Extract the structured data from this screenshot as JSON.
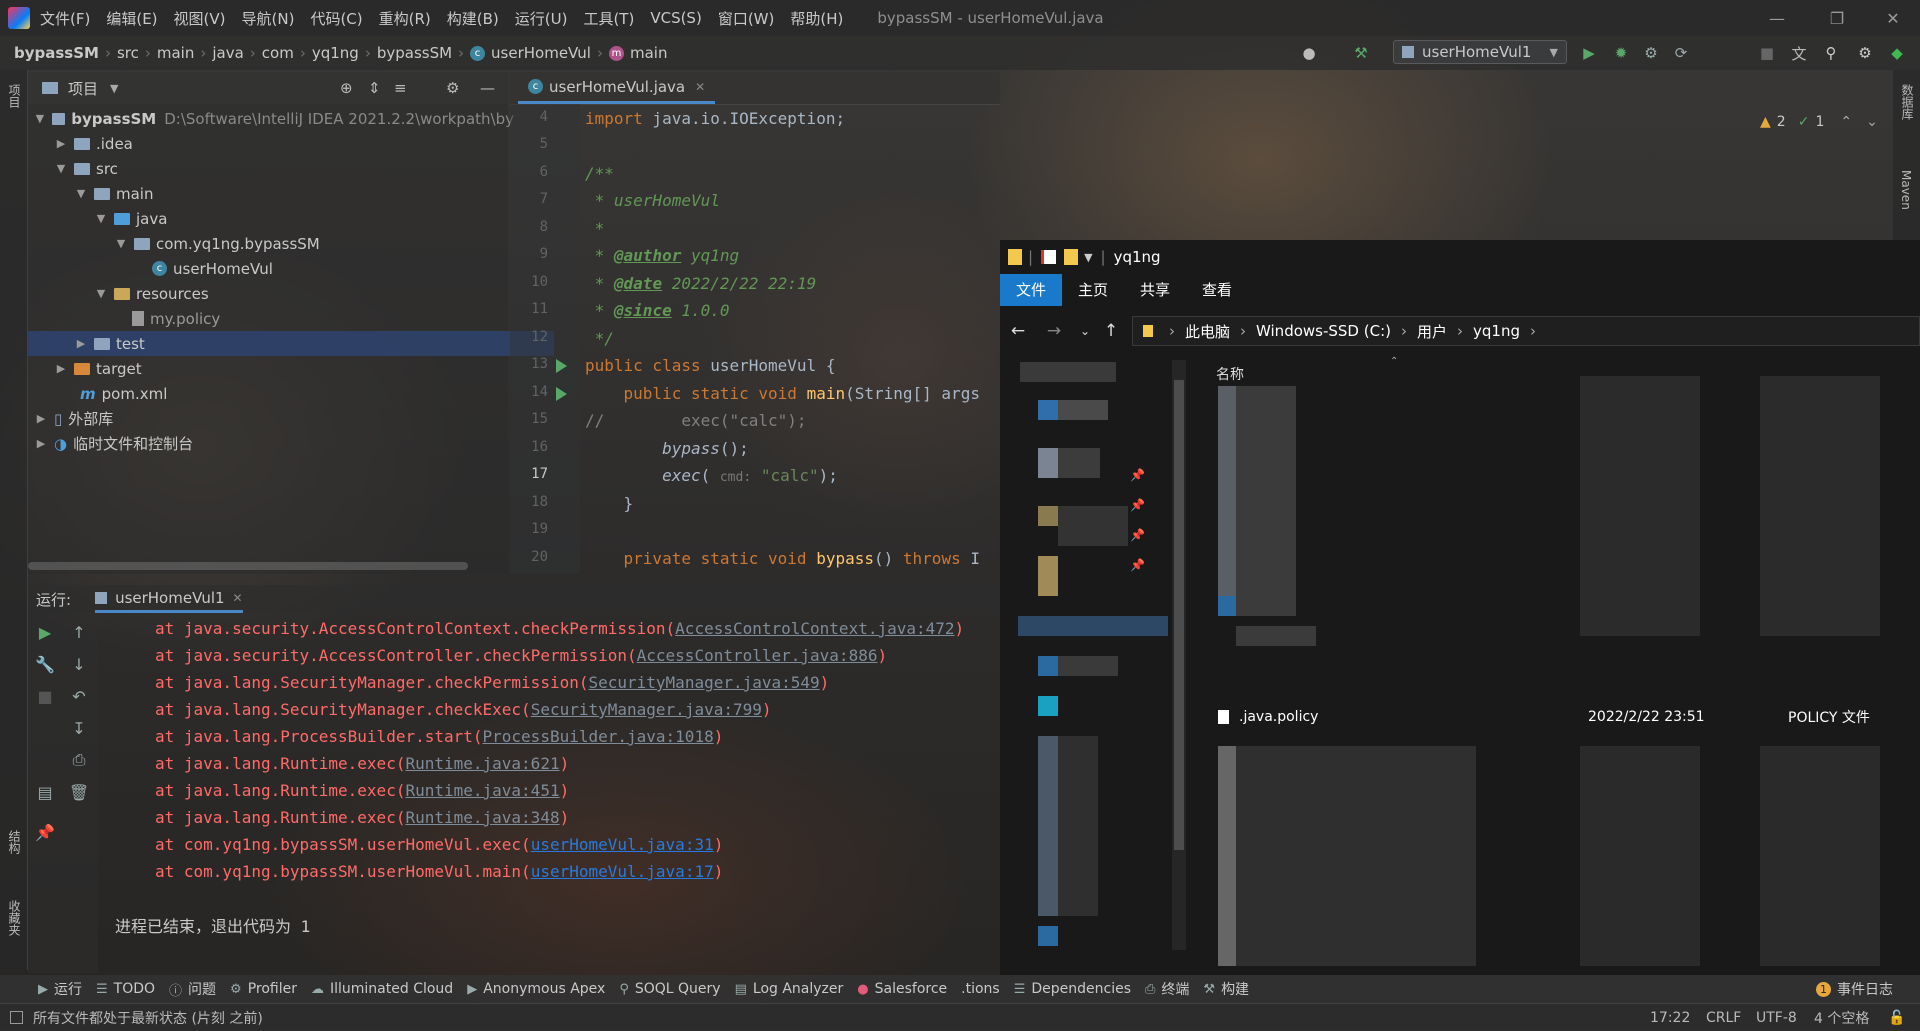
{
  "window": {
    "title": "bypassSM - userHomeVul.java",
    "menu": [
      "文件(F)",
      "编辑(E)",
      "视图(V)",
      "导航(N)",
      "代码(C)",
      "重构(R)",
      "构建(B)",
      "运行(U)",
      "工具(T)",
      "VCS(S)",
      "窗口(W)",
      "帮助(H)"
    ]
  },
  "breadcrumb": [
    "bypassSM",
    "src",
    "main",
    "java",
    "com",
    "yq1ng",
    "bypassSM",
    "userHomeVul",
    "main"
  ],
  "run_config": "userHomeVul1",
  "left_strip": {
    "project_label": "项目",
    "structure_label": "结构",
    "favorites_label": "收藏夹"
  },
  "right_strip": {
    "database_label": "数据库",
    "maven_label": "Maven"
  },
  "project": {
    "header": "项目",
    "tree": [
      {
        "label": "bypassSM",
        "extra": "D:\\Software\\IntelliJ IDEA 2021.2.2\\workpath\\by"
      },
      {
        "label": ".idea"
      },
      {
        "label": "src"
      },
      {
        "label": "main"
      },
      {
        "label": "java"
      },
      {
        "label": "com.yq1ng.bypassSM"
      },
      {
        "label": "userHomeVul"
      },
      {
        "label": "resources"
      },
      {
        "label": "my.policy"
      },
      {
        "label": "test"
      },
      {
        "label": "target"
      },
      {
        "label": "pom.xml"
      },
      {
        "label": "外部库"
      },
      {
        "label": "临时文件和控制台"
      }
    ]
  },
  "editor": {
    "tab": "userHomeVul.java",
    "inspections": {
      "warnings": "2",
      "ok": "1"
    },
    "line_numbers": [
      "4",
      "5",
      "6",
      "7",
      "8",
      "9",
      "10",
      "11",
      "12",
      "13",
      "14",
      "15",
      "16",
      "17",
      "18",
      "19",
      "20"
    ]
  },
  "run_panel": {
    "label": "运行:",
    "tab": "userHomeVul1",
    "stack": [
      {
        "text": "at java.security.AccessControlContext.checkPermission(",
        "link": "AccessControlContext.java:472",
        "end": ")"
      },
      {
        "text": "at java.security.AccessController.checkPermission(",
        "link": "AccessController.java:886",
        "end": ")"
      },
      {
        "text": "at java.lang.SecurityManager.checkPermission(",
        "link": "SecurityManager.java:549",
        "end": ")"
      },
      {
        "text": "at java.lang.SecurityManager.checkExec(",
        "link": "SecurityManager.java:799",
        "end": ")"
      },
      {
        "text": "at java.lang.ProcessBuilder.start(",
        "link": "ProcessBuilder.java:1018",
        "end": ")"
      },
      {
        "text": "at java.lang.Runtime.exec(",
        "link": "Runtime.java:621",
        "end": ")"
      },
      {
        "text": "at java.lang.Runtime.exec(",
        "link": "Runtime.java:451",
        "end": ")"
      },
      {
        "text": "at java.lang.Runtime.exec(",
        "link": "Runtime.java:348",
        "end": ")"
      },
      {
        "text": "at com.yq1ng.bypassSM.userHomeVul.exec(",
        "link": "userHomeVul.java:31",
        "end": ")"
      },
      {
        "text": "at com.yq1ng.bypassSM.userHomeVul.main(",
        "link": "userHomeVul.java:17",
        "end": ")"
      }
    ],
    "exit_message": "进程已结束，退出代码为 1"
  },
  "explorer": {
    "title": "yq1ng",
    "ribbon": [
      "文件",
      "主页",
      "共享",
      "查看"
    ],
    "address": [
      "此电脑",
      "Windows-SSD (C:)",
      "用户",
      "yq1ng"
    ],
    "column_name": "名称",
    "file": {
      "name": ".java.policy",
      "date": "2022/2/22 23:51",
      "type": "POLICY 文件"
    }
  },
  "bottom_bar": [
    "运行",
    "TODO",
    "问题",
    "Profiler",
    "Illuminated Cloud",
    "Anonymous Apex",
    "SOQL Query",
    "Log Analyzer",
    "Salesforce",
    ".tions",
    "Dependencies",
    "终端",
    "构建"
  ],
  "event_log": {
    "count": "1",
    "label": "事件日志"
  },
  "status": {
    "message": "所有文件都处于最新状态 (片刻 之前)",
    "position": "17:22",
    "line_sep": "CRLF",
    "encoding": "UTF-8",
    "indent": "4 个空格"
  },
  "colors": {
    "accent": "#1979ca",
    "error": "#ff6b68",
    "keyword": "#cc7832",
    "comment": "#629755"
  }
}
